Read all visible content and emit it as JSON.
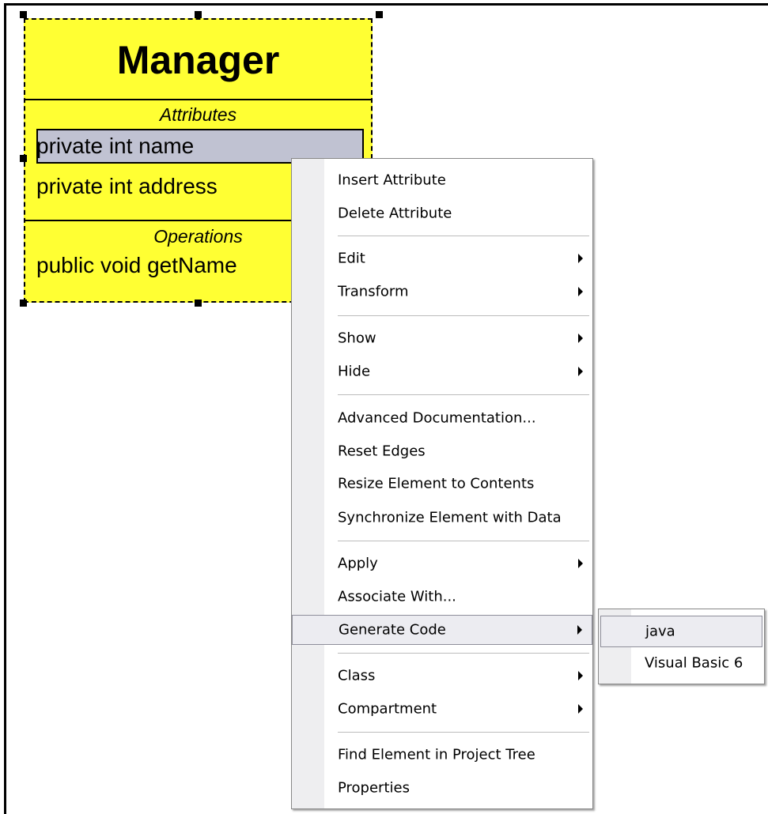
{
  "uml_class": {
    "name": "Manager",
    "attributes_label": "Attributes",
    "attributes": [
      "private int name",
      "private int address"
    ],
    "operations_label": "Operations",
    "operations": [
      "public void getName"
    ]
  },
  "context_menu": {
    "items": [
      {
        "label": "Insert Attribute",
        "submenu": false
      },
      {
        "label": "Delete Attribute",
        "submenu": false
      },
      {
        "label": "Edit",
        "submenu": true
      },
      {
        "label": "Transform",
        "submenu": true
      },
      {
        "label": "Show",
        "submenu": true
      },
      {
        "label": "Hide",
        "submenu": true
      },
      {
        "label": "Advanced Documentation...",
        "submenu": false
      },
      {
        "label": "Reset Edges",
        "submenu": false
      },
      {
        "label": "Resize Element to Contents",
        "submenu": false
      },
      {
        "label": "Synchronize Element with Data",
        "submenu": false
      },
      {
        "label": "Apply",
        "submenu": true
      },
      {
        "label": "Associate With...",
        "submenu": false
      },
      {
        "label": "Generate Code",
        "submenu": true,
        "highlighted": true
      },
      {
        "label": "Class",
        "submenu": true
      },
      {
        "label": "Compartment",
        "submenu": true
      },
      {
        "label": "Find Element in Project Tree",
        "submenu": false
      },
      {
        "label": "Properties",
        "submenu": false
      }
    ]
  },
  "generate_code_submenu": {
    "items": [
      {
        "label": "java",
        "highlighted": true
      },
      {
        "label": "Visual Basic 6"
      }
    ]
  },
  "colors": {
    "class_fill": "#ffff33",
    "selected_attribute": "#c0c2d2",
    "menu_gutter": "#eeeef0",
    "menu_highlight": "#ececf1"
  }
}
